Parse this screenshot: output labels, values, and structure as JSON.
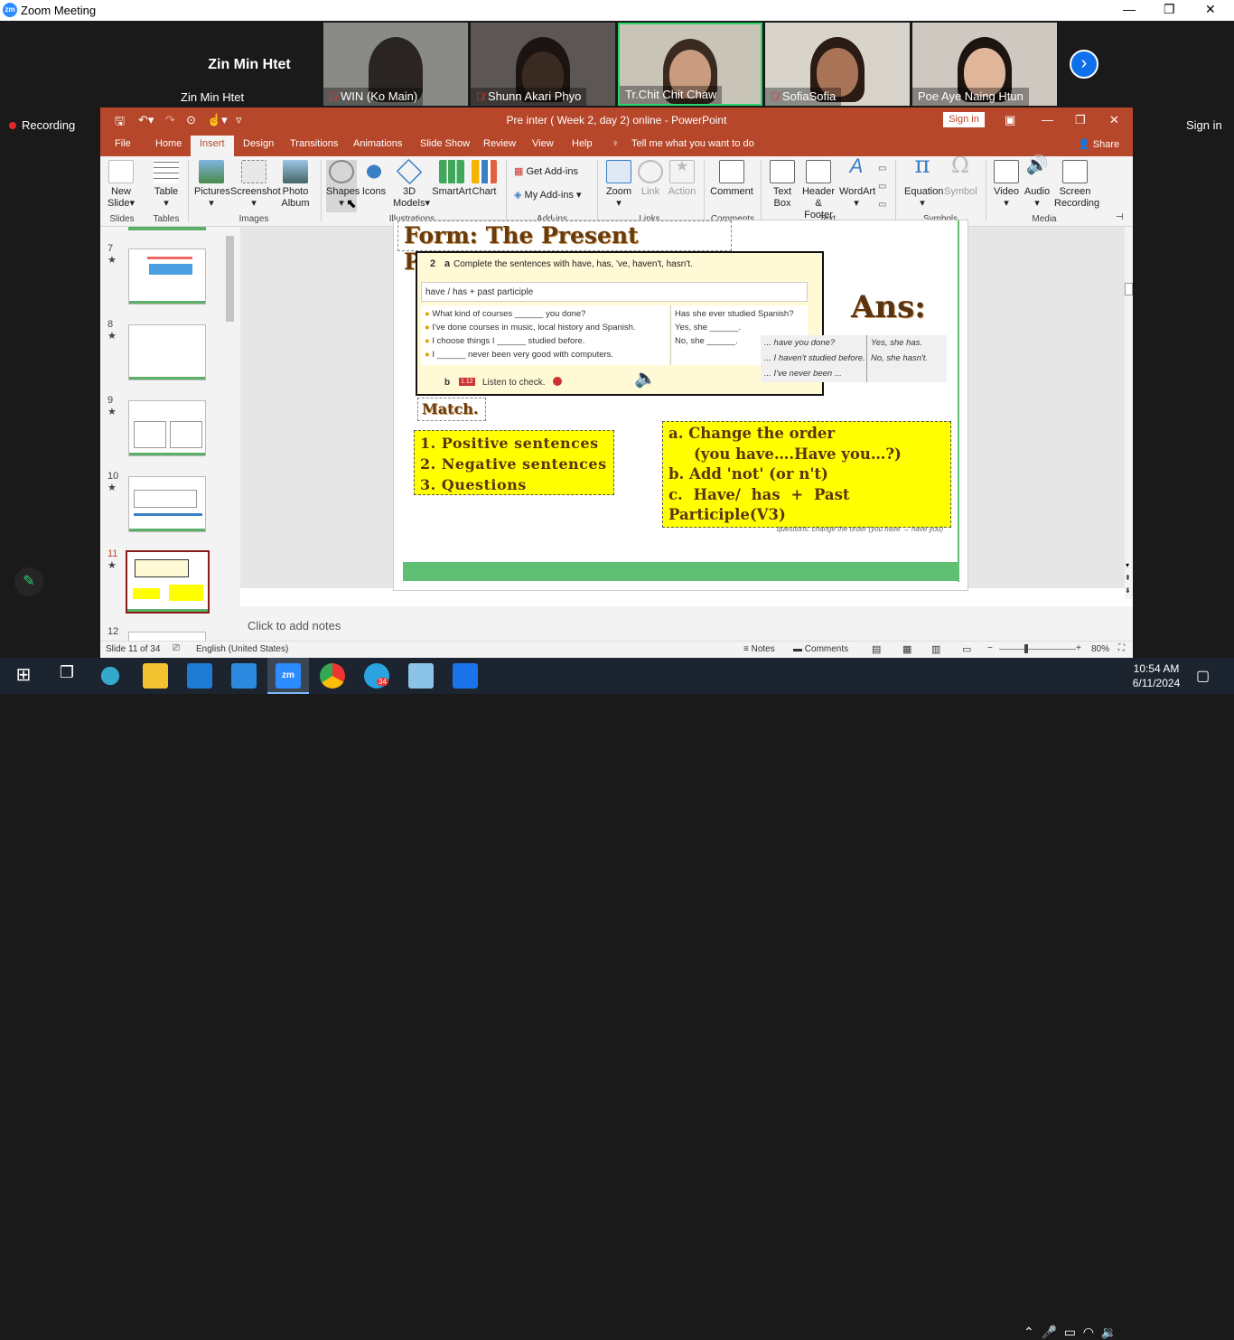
{
  "zoom": {
    "title": "Zoom Meeting",
    "recording": "Recording",
    "sign_in": "Sign in",
    "host_big": "Zin Min Htet",
    "host_name": "Zin Min Htet",
    "participants": [
      {
        "name": "WIN (Ko Main)",
        "muted": true
      },
      {
        "name": "Shunn Akari Phyo",
        "muted": true
      },
      {
        "name": "Tr.Chit Chit Chaw",
        "muted": false
      },
      {
        "name": "SofiaSofia",
        "muted": true
      },
      {
        "name": "Poe Aye Naing Htun",
        "muted": false
      }
    ]
  },
  "ppt": {
    "doc_title": "Pre inter ( Week 2, day 2) online  -  PowerPoint",
    "sign_in": "Sign in",
    "tabs": [
      "File",
      "Home",
      "Insert",
      "Design",
      "Transitions",
      "Animations",
      "Slide Show",
      "Review",
      "View",
      "Help"
    ],
    "tell_me": "Tell me what you want to do",
    "share": "Share",
    "ribbon": {
      "new_slide": "New Slide",
      "table": "Table",
      "pictures": "Pictures",
      "screenshot": "Screenshot",
      "photo_album": "Photo Album",
      "shapes": "Shapes",
      "icons": "Icons",
      "models": "3D Models",
      "smartart": "SmartArt",
      "chart": "Chart",
      "get_addins": "Get Add-ins",
      "my_addins": "My Add-ins",
      "zoom": "Zoom",
      "link": "Link",
      "action": "Action",
      "comment": "Comment",
      "textbox": "Text Box",
      "header_footer": "Header & Footer",
      "wordart": "WordArt",
      "equation": "Equation",
      "symbol": "Symbol",
      "video": "Video",
      "audio": "Audio",
      "screen_recording": "Screen Recording",
      "groups": {
        "slides": "Slides",
        "tables": "Tables",
        "images": "Images",
        "illustrations": "Illustrations",
        "addins": "Add-ins",
        "links": "Links",
        "comments": "Comments",
        "text": "Text",
        "symbols": "Symbols",
        "media": "Media"
      }
    },
    "thumbs": [
      "7",
      "8",
      "9",
      "10",
      "11",
      "12"
    ],
    "star": "★",
    "notes": "Click to add notes",
    "status": {
      "slide": "Slide 11 of 34",
      "lang": "English (United States)",
      "notes": "Notes",
      "comments": "Comments",
      "zoom": "80%"
    }
  },
  "slide": {
    "title": "Form: The Present Perfect",
    "ex_num": "2",
    "ex_a": "a",
    "ex_instr": "Complete the sentences with have, has, 've, haven't, hasn't.",
    "rule": "have / has + past participle",
    "lines": [
      "What kind of courses ______ you done?",
      "I've done courses in music, local history and Spanish.",
      "I choose things I ______ studied before.",
      "I ______ never been very good with computers."
    ],
    "right_lines": [
      "Has she ever studied Spanish?",
      "Yes, she ______.",
      "No, she ______."
    ],
    "ex_b": "b",
    "listen_tag": "1.12",
    "listen": "Listen to check.",
    "ans_title": "Ans:",
    "ans_left": [
      "... have you done?",
      "... I haven't studied before.",
      "... I've never been ..."
    ],
    "ans_right": [
      "Yes, she has.",
      "No, she hasn't."
    ],
    "match": "Match.",
    "left_box": [
      "1.  Positive sentences",
      "2.  Negative sentences",
      "3.  Questions"
    ],
    "right_box": [
      "a.  Change the order",
      "(you have….Have you…?)",
      "b. Add 'not' (or n't)",
      "c.    Have/    has    +    Past",
      "Participle(V3)"
    ],
    "footnote": "questions: change the order (you have → have you)"
  },
  "taskbar": {
    "time": "10:54 AM",
    "date": "6/11/2024",
    "badge": "34"
  }
}
